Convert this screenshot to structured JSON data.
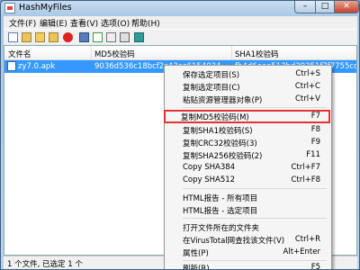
{
  "window": {
    "title": "HashMyFiles"
  },
  "menubar": [
    "文件(F)",
    "编辑(E)",
    "查看(V)",
    "选项(O)",
    "帮助(H)"
  ],
  "columns": [
    "文件名",
    "MD5校验码",
    "SHA1校验码"
  ],
  "row": {
    "filename": "zy7.0.apk",
    "md5": "9036d536c18bcf2c43ec6154034",
    "sha1": "fb4d6eee513bd39251f7f7755ccf0f4a6"
  },
  "status": "1 个文件, 已选定 1 个",
  "context_menu": {
    "items": [
      {
        "label": "保存选定项目(S)",
        "shortcut": "Ctrl+S"
      },
      {
        "label": "复制选定项目(C)",
        "shortcut": "Ctrl+C"
      },
      {
        "label": "粘贴资源管理器对象(P)",
        "shortcut": "Ctrl+V"
      },
      {
        "label": "复制MD5校验码(M)",
        "shortcut": "F7"
      },
      {
        "label": "复制SHA1校验码(S)",
        "shortcut": "F8"
      },
      {
        "label": "复制CRC32校验码(3)",
        "shortcut": "F9"
      },
      {
        "label": "复制SHA256校验码(2)",
        "shortcut": "F11"
      },
      {
        "label": "Copy SHA384",
        "shortcut": "Ctrl+F7"
      },
      {
        "label": "Copy SHA512",
        "shortcut": "Ctrl+F8"
      },
      {
        "label": "HTML报告 - 所有项目",
        "shortcut": ""
      },
      {
        "label": "HTML报告 - 选定项目",
        "shortcut": ""
      },
      {
        "label": "打开文件所在的文件夹",
        "shortcut": ""
      },
      {
        "label": "在VirusTotal网查找该文件(V)",
        "shortcut": "Ctrl+R"
      },
      {
        "label": "属性(P)",
        "shortcut": "Alt+Enter"
      },
      {
        "label": "刷新(R)",
        "shortcut": "F5"
      }
    ]
  },
  "colors": {
    "selection": "#3399ff",
    "highlight_box": "#e53333"
  }
}
